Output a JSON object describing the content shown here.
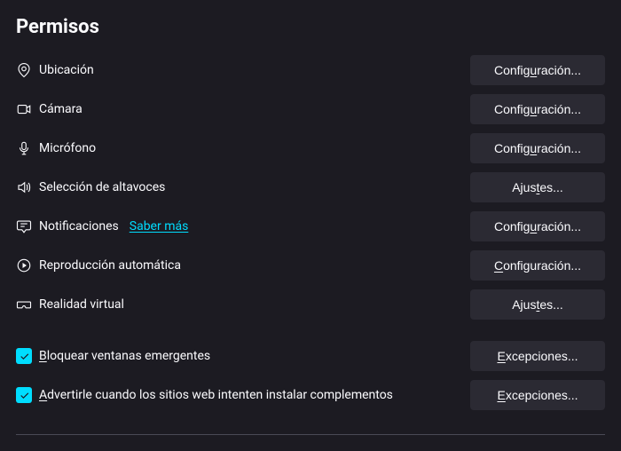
{
  "section": {
    "title": "Permisos"
  },
  "rows": {
    "location": {
      "label": "Ubicación",
      "button": "Configuración...",
      "button_u": "u"
    },
    "camera": {
      "label": "Cámara",
      "button": "Configuración...",
      "button_u": "u"
    },
    "microphone": {
      "label": "Micrófono",
      "button": "Configuración...",
      "button_u": "u"
    },
    "speaker": {
      "label": "Selección de altavoces",
      "button": "Ajustes...",
      "button_u": "t"
    },
    "notifications": {
      "label": "Notificaciones",
      "link": "Saber más",
      "button": "Configuración...",
      "button_u": "u"
    },
    "autoplay": {
      "label": "Reproducción automática",
      "button": "Configuración...",
      "button_u": "C"
    },
    "vr": {
      "label": "Realidad virtual",
      "button": "Ajustes...",
      "button_u": "t"
    },
    "popup": {
      "label": "Bloquear ventanas emergentes",
      "label_u": "B",
      "button": "Excepciones...",
      "button_u": "E"
    },
    "addons": {
      "label": "Advertirle cuando los sitios web intenten instalar complementos",
      "label_u": "A",
      "button": "Excepciones...",
      "button_u": "E"
    }
  }
}
